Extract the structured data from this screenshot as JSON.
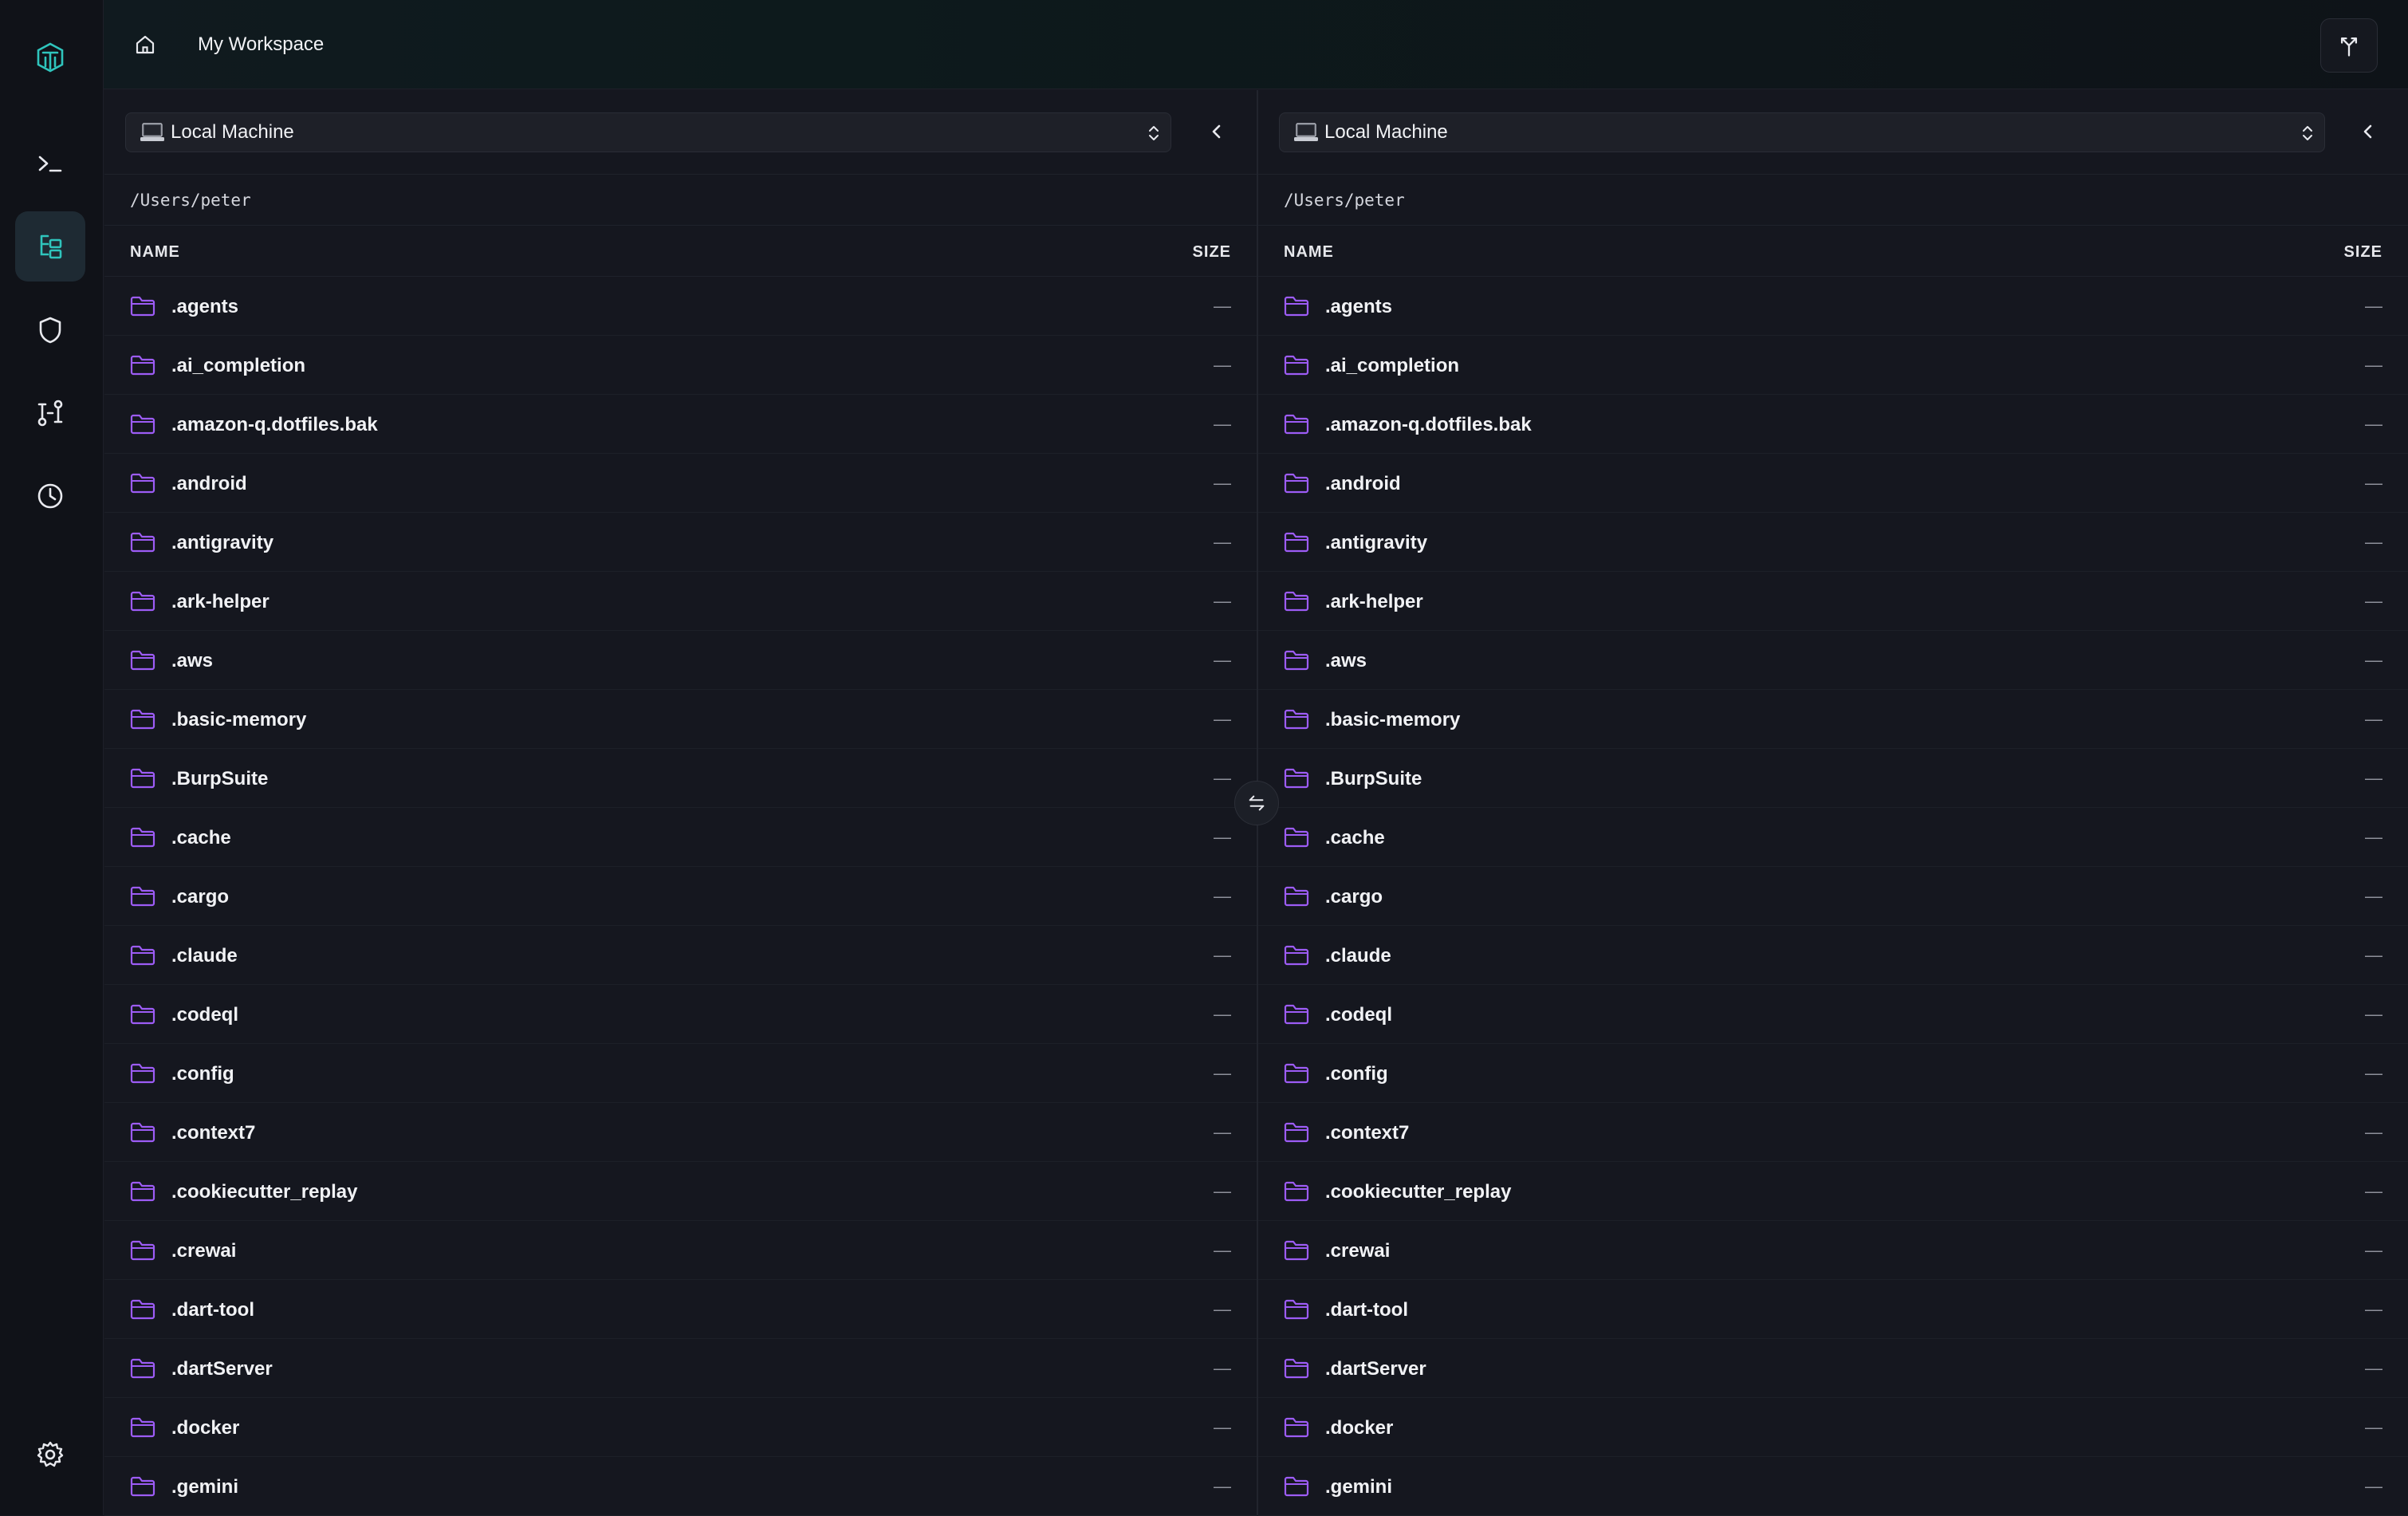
{
  "header": {
    "title": "My Workspace"
  },
  "sidebar": {
    "items": [
      {
        "name": "terminal",
        "icon": "terminal-icon"
      },
      {
        "name": "file-transfer",
        "icon": "tree-icon",
        "active": true
      },
      {
        "name": "security",
        "icon": "shield-icon"
      },
      {
        "name": "routing",
        "icon": "path-icon"
      },
      {
        "name": "history",
        "icon": "clock-icon"
      },
      {
        "name": "settings",
        "icon": "gear-icon"
      }
    ]
  },
  "colors": {
    "accent": "#2fc5bd",
    "folder": "#9d5cf6",
    "background": "#15171f"
  },
  "panes": {
    "left": {
      "machine": "Local Machine",
      "path": "/Users/peter",
      "col_name": "NAME",
      "col_size": "SIZE"
    },
    "right": {
      "machine": "Local Machine",
      "path": "/Users/peter",
      "col_name": "NAME",
      "col_size": "SIZE"
    }
  },
  "files": [
    {
      "name": ".agents",
      "size": "—"
    },
    {
      "name": ".ai_completion",
      "size": "—"
    },
    {
      "name": ".amazon-q.dotfiles.bak",
      "size": "—"
    },
    {
      "name": ".android",
      "size": "—"
    },
    {
      "name": ".antigravity",
      "size": "—"
    },
    {
      "name": ".ark-helper",
      "size": "—"
    },
    {
      "name": ".aws",
      "size": "—"
    },
    {
      "name": ".basic-memory",
      "size": "—"
    },
    {
      "name": ".BurpSuite",
      "size": "—"
    },
    {
      "name": ".cache",
      "size": "—"
    },
    {
      "name": ".cargo",
      "size": "—"
    },
    {
      "name": ".claude",
      "size": "—"
    },
    {
      "name": ".codeql",
      "size": "—"
    },
    {
      "name": ".config",
      "size": "—"
    },
    {
      "name": ".context7",
      "size": "—"
    },
    {
      "name": ".cookiecutter_replay",
      "size": "—"
    },
    {
      "name": ".crewai",
      "size": "—"
    },
    {
      "name": ".dart-tool",
      "size": "—"
    },
    {
      "name": ".dartServer",
      "size": "—"
    },
    {
      "name": ".docker",
      "size": "—"
    },
    {
      "name": ".gemini",
      "size": "—"
    }
  ]
}
